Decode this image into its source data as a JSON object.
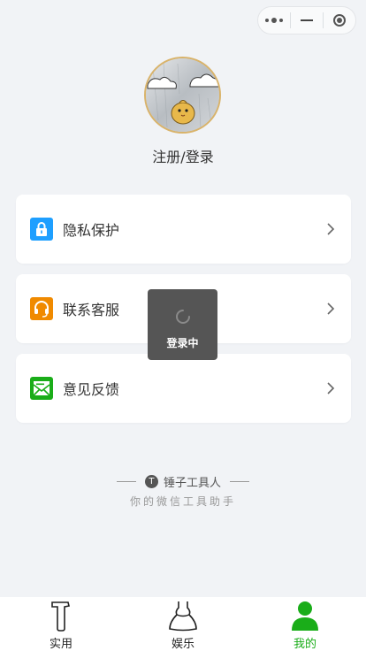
{
  "capsule": {
    "more": "more-dots-icon",
    "minimize": "minus-icon",
    "close": "target-circle-icon"
  },
  "profile": {
    "avatar": "avatar-cartoon-chick",
    "login_label": "注册/登录"
  },
  "menu": [
    {
      "label": "隐私保护",
      "icon": "lock-icon",
      "color": "#1e9fff"
    },
    {
      "label": "联系客服",
      "icon": "headset-icon",
      "color": "#f08a00"
    },
    {
      "label": "意见反馈",
      "icon": "feedback-mail-icon",
      "color": "#1aad19"
    }
  ],
  "toast": {
    "message": "登录中"
  },
  "footer": {
    "brand_badge": "T",
    "brand": "锤子工具人",
    "tagline": "你的微信工具助手"
  },
  "tabbar": [
    {
      "label": "实用",
      "icon": "hammer-icon"
    },
    {
      "label": "娱乐",
      "icon": "dress-icon"
    },
    {
      "label": "我的",
      "icon": "person-icon",
      "active": true
    }
  ],
  "colors": {
    "active": "#1aad19",
    "background": "#f1f3f6"
  }
}
